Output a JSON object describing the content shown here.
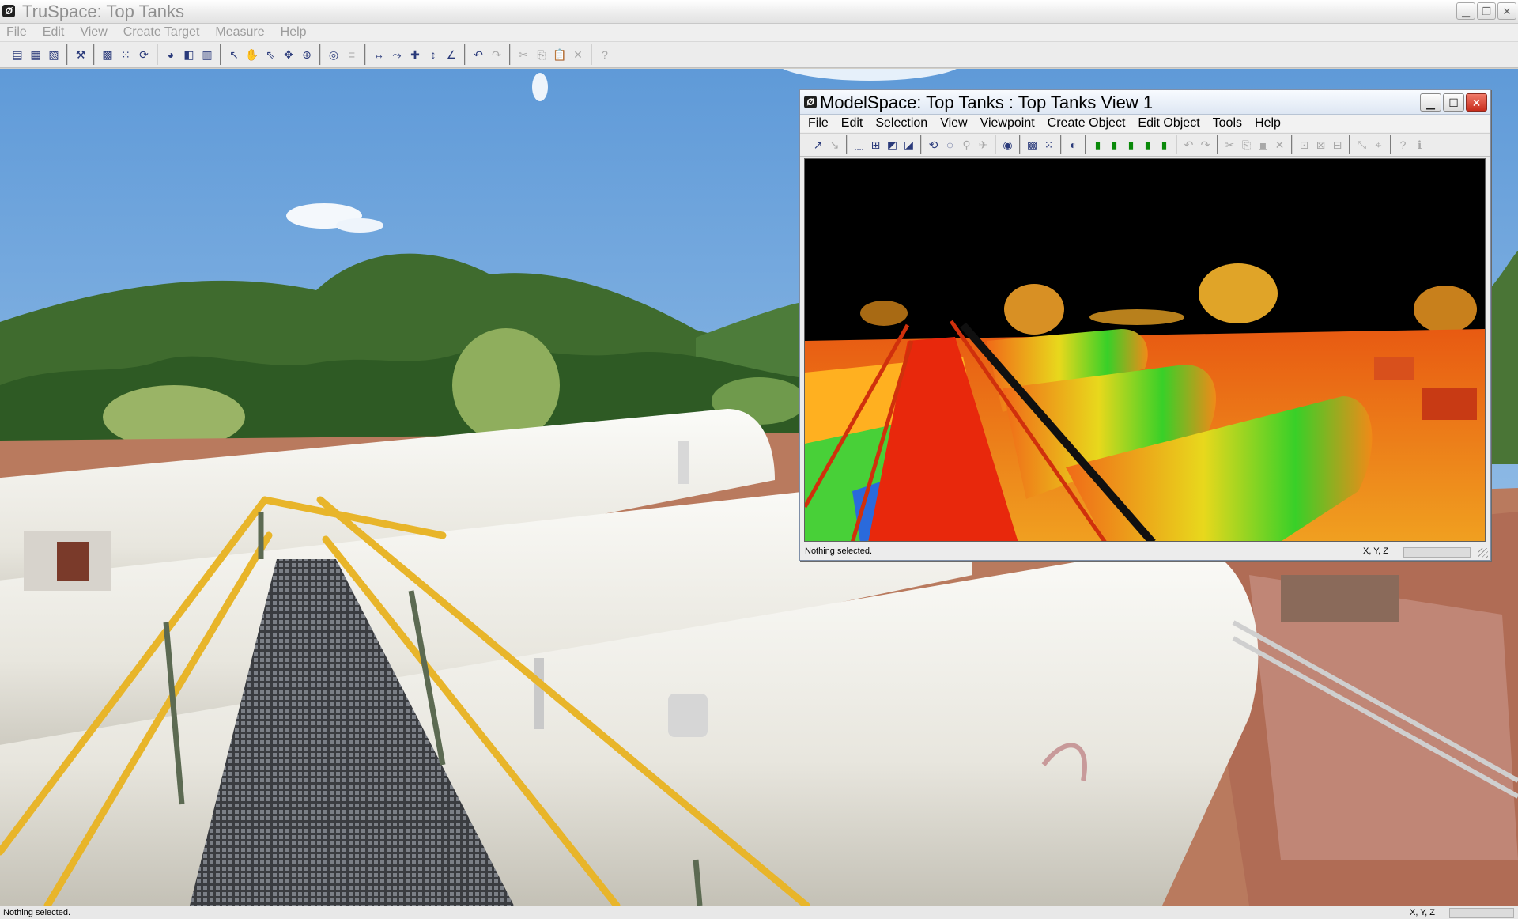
{
  "main_window": {
    "title": "TruSpace: Top Tanks",
    "menu": [
      "File",
      "Edit",
      "View",
      "Create Target",
      "Measure",
      "Help"
    ],
    "status": "Nothing selected.",
    "coord_label": "X, Y, Z"
  },
  "model_window": {
    "title": "ModelSpace: Top Tanks : Top Tanks View 1",
    "menu": [
      "File",
      "Edit",
      "Selection",
      "View",
      "Viewpoint",
      "Create Object",
      "Edit Object",
      "Tools",
      "Help"
    ],
    "status": "Nothing selected.",
    "coord_label": "X, Y, Z"
  },
  "icons": {
    "app": "truspace-app-icon",
    "minimize": "minimize-icon",
    "restore": "restore-icon",
    "maximize": "maximize-icon",
    "close": "close-icon"
  },
  "colors": {
    "sky": "#7fb2e3",
    "railing": "#e8b52a",
    "tank": "#ecebe4",
    "hills": "#3f6b2e",
    "ground": "#b97a5e",
    "close_button": "#c72c1c",
    "pointcloud_background": "#000000"
  }
}
